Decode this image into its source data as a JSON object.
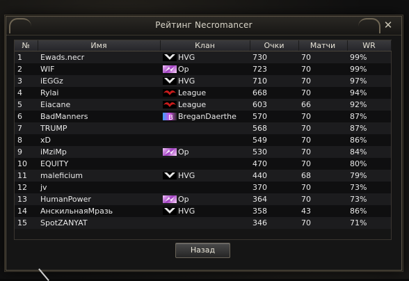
{
  "window": {
    "title": "Рейтинг Necromancer",
    "close_glyph": "✕",
    "back_button": "Назад"
  },
  "columns": [
    "№",
    "Имя",
    "Клан",
    "Очки",
    "Матчи",
    "WR"
  ],
  "rows": [
    {
      "num": "1",
      "name": "Ewads.necr",
      "clan": "HVG",
      "emblem": "hvg-emblem-icon",
      "points": "730",
      "matches": "70",
      "wr": "99%"
    },
    {
      "num": "2",
      "name": "WIF",
      "clan": "Op",
      "emblem": "op-emblem-icon",
      "points": "723",
      "matches": "70",
      "wr": "99%"
    },
    {
      "num": "3",
      "name": "iEGGz",
      "clan": "HVG",
      "emblem": "hvg-emblem-icon",
      "points": "710",
      "matches": "70",
      "wr": "97%"
    },
    {
      "num": "4",
      "name": "Rylai",
      "clan": "League",
      "emblem": "league-emblem-icon",
      "points": "668",
      "matches": "70",
      "wr": "94%"
    },
    {
      "num": "5",
      "name": "Eiacane",
      "clan": "League",
      "emblem": "league-emblem-icon",
      "points": "603",
      "matches": "66",
      "wr": "92%"
    },
    {
      "num": "6",
      "name": "BadManners",
      "clan": "BreganDaerthe",
      "emblem": "breganDaerthe-emblem-icon",
      "points": "570",
      "matches": "70",
      "wr": "87%"
    },
    {
      "num": "7",
      "name": "TRUMP",
      "clan": "",
      "emblem": "",
      "points": "568",
      "matches": "70",
      "wr": "87%"
    },
    {
      "num": "8",
      "name": "xD",
      "clan": "",
      "emblem": "",
      "points": "549",
      "matches": "70",
      "wr": "86%"
    },
    {
      "num": "9",
      "name": "iMziMp",
      "clan": "Op",
      "emblem": "op-emblem-icon",
      "points": "530",
      "matches": "70",
      "wr": "84%"
    },
    {
      "num": "10",
      "name": "EQUITY",
      "clan": "",
      "emblem": "",
      "points": "470",
      "matches": "70",
      "wr": "80%"
    },
    {
      "num": "11",
      "name": "maleficium",
      "clan": "HVG",
      "emblem": "hvg-emblem-icon",
      "points": "440",
      "matches": "68",
      "wr": "79%"
    },
    {
      "num": "12",
      "name": "jv",
      "clan": "",
      "emblem": "",
      "points": "370",
      "matches": "70",
      "wr": "73%"
    },
    {
      "num": "13",
      "name": "HumanPower",
      "clan": "Op",
      "emblem": "op-emblem-icon",
      "points": "364",
      "matches": "70",
      "wr": "73%"
    },
    {
      "num": "14",
      "name": "АнскильнаяМразь",
      "clan": "HVG",
      "emblem": "hvg-emblem-icon",
      "points": "358",
      "matches": "43",
      "wr": "86%"
    },
    {
      "num": "15",
      "name": "SpotZANYAT",
      "clan": "",
      "emblem": "",
      "points": "346",
      "matches": "70",
      "wr": "71%"
    }
  ]
}
